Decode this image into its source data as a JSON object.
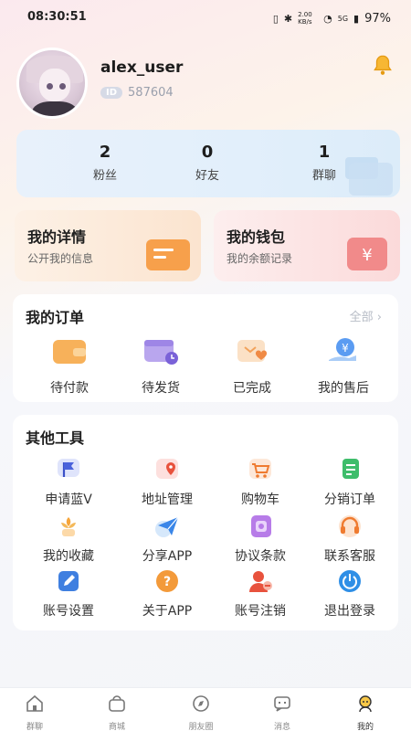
{
  "status": {
    "time": "08:30:51",
    "network": "2.00 KB/s",
    "signal_label": "5G",
    "battery": "97%"
  },
  "profile": {
    "username": "alex_user",
    "id_badge": "ID",
    "id_value": "587604"
  },
  "stats": [
    {
      "value": "2",
      "label": "粉丝"
    },
    {
      "value": "0",
      "label": "好友"
    },
    {
      "value": "1",
      "label": "群聊"
    }
  ],
  "quick_cards": {
    "details": {
      "title": "我的详情",
      "subtitle": "公开我的信息"
    },
    "wallet": {
      "title": "我的钱包",
      "subtitle": "我的余额记录"
    }
  },
  "orders": {
    "title": "我的订单",
    "see_all": "全部",
    "items": [
      {
        "label": "待付款",
        "icon": "wallet-icon"
      },
      {
        "label": "待发货",
        "icon": "calendar-clock-icon"
      },
      {
        "label": "已完成",
        "icon": "heart-box-icon"
      },
      {
        "label": "我的售后",
        "icon": "yen-hand-icon"
      }
    ]
  },
  "tools": {
    "title": "其他工具",
    "items": [
      {
        "label": "申请蓝V",
        "icon": "flag-icon"
      },
      {
        "label": "地址管理",
        "icon": "map-pin-icon"
      },
      {
        "label": "购物车",
        "icon": "cart-icon"
      },
      {
        "label": "分销订单",
        "icon": "list-icon"
      },
      {
        "label": "我的收藏",
        "icon": "flower-icon"
      },
      {
        "label": "分享APP",
        "icon": "paper-plane-icon"
      },
      {
        "label": "协议条款",
        "icon": "document-icon"
      },
      {
        "label": "联系客服",
        "icon": "headset-icon"
      },
      {
        "label": "账号设置",
        "icon": "edit-icon"
      },
      {
        "label": "关于APP",
        "icon": "question-icon"
      },
      {
        "label": "账号注销",
        "icon": "user-remove-icon"
      },
      {
        "label": "退出登录",
        "icon": "power-icon"
      }
    ]
  },
  "tabbar": [
    {
      "label": "群聊",
      "icon": "home-icon",
      "active": false
    },
    {
      "label": "商城",
      "icon": "bag-icon",
      "active": false
    },
    {
      "label": "朋友圈",
      "icon": "compass-icon",
      "active": false
    },
    {
      "label": "消息",
      "icon": "chat-icon",
      "active": false
    },
    {
      "label": "我的",
      "icon": "profile-icon",
      "active": true
    }
  ],
  "colors": {
    "accent": "#f5a623",
    "blue": "#3a86e8",
    "red": "#e8523d"
  }
}
